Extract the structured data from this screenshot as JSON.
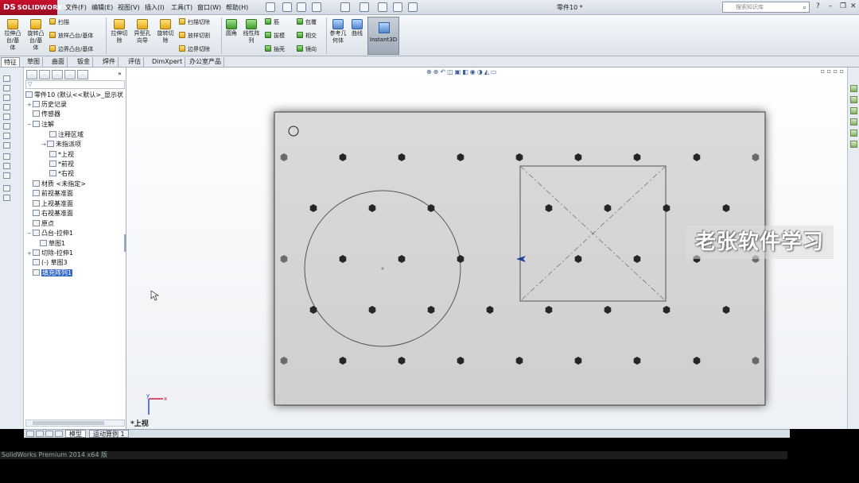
{
  "app": {
    "logo": "SOLIDWORKS",
    "doc_title": "零件10 *",
    "search_placeholder": "搜索知识库"
  },
  "menu": [
    "文件(F)",
    "编辑(E)",
    "视图(V)",
    "插入(I)",
    "工具(T)",
    "窗口(W)",
    "帮助(H)"
  ],
  "ribbon": {
    "extrude_boss": "拉伸凸\n台/基\n体",
    "revolve_boss": "旋转凸\n台/基\n体",
    "sweep": "扫描",
    "loft_boss": "放样凸台/基体",
    "boundary_boss": "边界凸台/基体",
    "extrude_cut": "拉伸切\n除",
    "hole_wizard": "异型孔\n向导",
    "revolve_cut": "旋转切\n除",
    "swept_cut": "扫描切除",
    "lofted_cut": "放样切割",
    "boundary_cut": "边界切除",
    "fillet": "圆角",
    "linear_pattern": "线性阵\n列",
    "rib": "筋",
    "draft": "拔模",
    "shell": "抽壳",
    "wrap": "包覆",
    "intersect": "相交",
    "mirror": "镜向",
    "ref_geometry": "参考几\n何体",
    "curves": "曲线",
    "instant3d": "Instant3D"
  },
  "tabs": [
    "特征",
    "草图",
    "曲面",
    "钣金",
    "焊件",
    "评估",
    "DimXpert",
    "办公室产品"
  ],
  "tree": {
    "root": "零件10 (默认<<默认>_显示状",
    "items": [
      {
        "label": "历史记录"
      },
      {
        "label": "传感器"
      },
      {
        "label": "注解"
      },
      {
        "label": "注释区域"
      },
      {
        "label": "未指派项"
      },
      {
        "label": "*上视"
      },
      {
        "label": "*前视"
      },
      {
        "label": "*右视"
      },
      {
        "label": "材质 <未指定>"
      },
      {
        "label": "前视基准面"
      },
      {
        "label": "上视基准面"
      },
      {
        "label": "右视基准面"
      },
      {
        "label": "原点"
      },
      {
        "label": "凸台-拉伸1"
      },
      {
        "label": "草图1"
      },
      {
        "label": "切除-拉伸1"
      },
      {
        "label": "(-) 草图3"
      },
      {
        "label": "填充阵列1"
      }
    ]
  },
  "view_label": "*上视",
  "watermark": "老张软件学习",
  "bottom_tabs": [
    "模型",
    "运动算例 1"
  ],
  "status": "SolidWorks Premium 2014 x64 版",
  "colors": {
    "brand": "#c8102e",
    "selection": "#3167c8",
    "plate": "#d4d4d4"
  }
}
